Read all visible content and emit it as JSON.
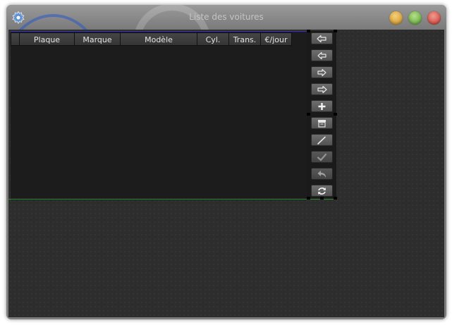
{
  "window": {
    "title": "Liste des voitures",
    "controls": [
      "minimize",
      "maximize",
      "close"
    ],
    "app_icon": "gear-icon"
  },
  "table": {
    "columns": [
      "Plaque",
      "Marque",
      "Modèle",
      "Cyl.",
      "Trans.",
      "€/jour"
    ],
    "rows": []
  },
  "toolbar": {
    "buttons": [
      {
        "name": "first-icon",
        "enabled": true
      },
      {
        "name": "previous-icon",
        "enabled": true
      },
      {
        "name": "next-icon",
        "enabled": true
      },
      {
        "name": "last-icon",
        "enabled": true
      },
      {
        "name": "add-icon",
        "enabled": true
      },
      {
        "name": "delete-icon",
        "enabled": true
      },
      {
        "name": "edit-icon",
        "enabled": true
      },
      {
        "name": "confirm-icon",
        "enabled": false
      },
      {
        "name": "undo-icon",
        "enabled": false
      },
      {
        "name": "refresh-icon",
        "enabled": true
      }
    ]
  },
  "colors": {
    "window_frame": "#7d7d7d",
    "client_background": "#2d2d2d",
    "table_background": "#1c1c1c",
    "header_background": "#3c3c3c",
    "header_text": "#e4e4e4",
    "button_background": "#5f5f5f",
    "icon_color": "#e6e6e6",
    "title_text": "#c4c4c4",
    "minimize": "#e3ac3f",
    "maximize": "#7bc24f",
    "close": "#dc4b40"
  }
}
